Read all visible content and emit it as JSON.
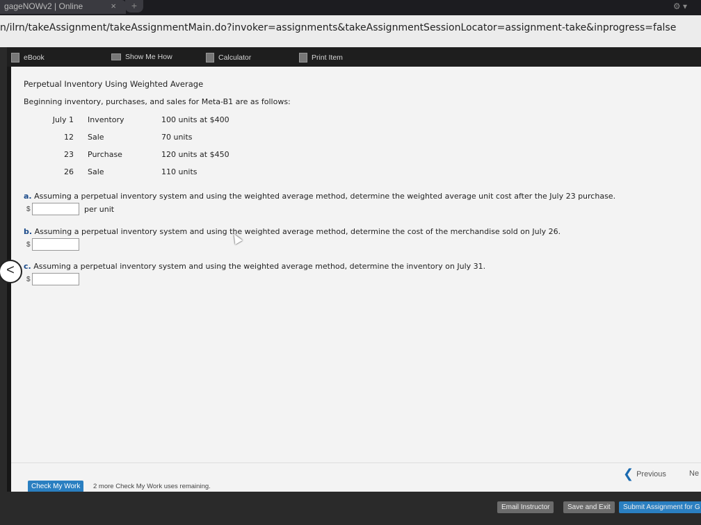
{
  "browser": {
    "tab_title": "gageNOWv2 | Online",
    "tab_close": "×",
    "new_tab": "+",
    "url": "n/ilrn/takeAssignment/takeAssignmentMain.do?invoker=assignments&takeAssignmentSessionLocator=assignment-take&inprogress=false"
  },
  "toolbar": {
    "ebook": "eBook",
    "show_me_how": "Show Me How",
    "calculator": "Calculator",
    "print_item": "Print Item"
  },
  "problem": {
    "title": "Perpetual Inventory Using Weighted Average",
    "intro": "Beginning inventory, purchases, and sales for Meta-B1 are as follows:",
    "rows": [
      {
        "date": "July 1",
        "desc": "Inventory",
        "detail": "100 units at $400"
      },
      {
        "date": "12",
        "desc": "Sale",
        "detail": "70 units"
      },
      {
        "date": "23",
        "desc": "Purchase",
        "detail": "120 units at $450"
      },
      {
        "date": "26",
        "desc": "Sale",
        "detail": "110 units"
      }
    ],
    "questions": [
      {
        "letter": "a.",
        "text": "Assuming a perpetual inventory system and using the weighted average method, determine the weighted average unit cost after the July 23 purchase.",
        "prefix": "$",
        "suffix": "per unit",
        "value": ""
      },
      {
        "letter": "b.",
        "text": "Assuming a perpetual inventory system and using the weighted average method, determine the cost of the merchandise sold on July 26.",
        "prefix": "$",
        "suffix": "",
        "value": ""
      },
      {
        "letter": "c.",
        "text": "Assuming a perpetual inventory system and using the weighted average method, determine the inventory on July 31.",
        "prefix": "$",
        "suffix": "",
        "value": ""
      }
    ]
  },
  "nav": {
    "back_glyph": "<",
    "previous": "Previous",
    "previous_glyph": "❮",
    "next": "Ne"
  },
  "footer": {
    "check_my_work": "Check My Work",
    "remaining": "2 more Check My Work uses remaining.",
    "email_instructor": "Email Instructor",
    "save_and_exit": "Save and Exit",
    "submit": "Submit Assignment for G"
  },
  "colors": {
    "accent_blue": "#2a7fc1",
    "page_bg": "#f3f3f3",
    "toolbar_bg": "#1e1e1e"
  }
}
